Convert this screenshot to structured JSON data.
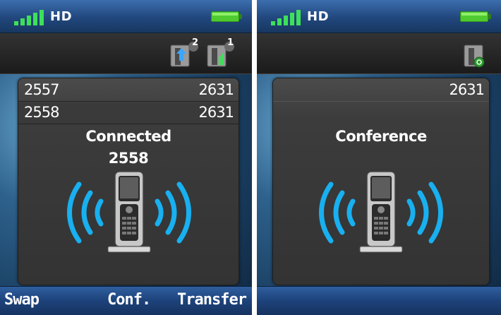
{
  "colors": {
    "signal": "#3ee05a",
    "battery": "#4fcb2f",
    "wave": "#18b0f0",
    "softbar": "#1d427a",
    "panel": "#3c3c3c"
  },
  "left_screen": {
    "status": {
      "hd_label": "HD",
      "signal_icon": "signal-bars-icon",
      "battery_icon": "battery-icon"
    },
    "toolbar": {
      "icons": [
        {
          "name": "held-call-icon",
          "badge": "2"
        },
        {
          "name": "active-call-icon",
          "badge": "1"
        }
      ]
    },
    "calls": [
      {
        "number": "2557",
        "line": "2631"
      },
      {
        "number": "2558",
        "line": "2631"
      }
    ],
    "state_label": "Connected",
    "state_number": "2558",
    "softkeys": [
      "Swap",
      "Conf.",
      "Transfer"
    ]
  },
  "right_screen": {
    "status": {
      "hd_label": "HD",
      "signal_icon": "signal-bars-icon",
      "battery_icon": "battery-icon"
    },
    "toolbar": {
      "icons": [
        {
          "name": "conference-icon"
        }
      ]
    },
    "line": "2631",
    "state_label": "Conference"
  }
}
